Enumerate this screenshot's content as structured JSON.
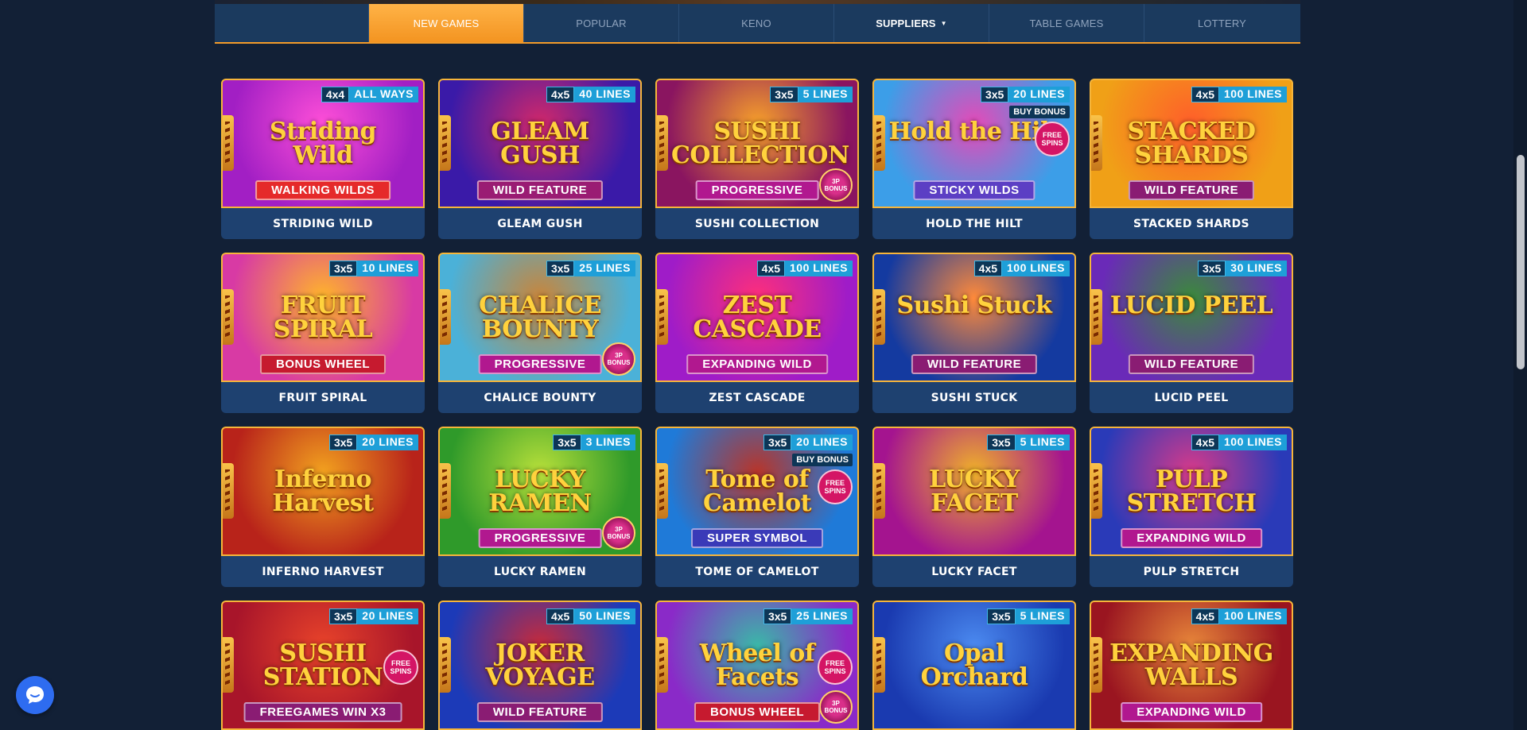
{
  "nav": {
    "tabs": [
      {
        "label": "NEW GAMES",
        "active": true
      },
      {
        "label": "POPULAR",
        "active": false
      },
      {
        "label": "KENO",
        "active": false
      },
      {
        "label": "SUPPLIERS",
        "active": false,
        "dropdown": true
      },
      {
        "label": "TABLE GAMES",
        "active": false
      },
      {
        "label": "LOTTERY",
        "active": false
      }
    ]
  },
  "games": [
    {
      "name": "STRIDING WILD",
      "art_title": "Striding Wild",
      "grid": "4x4",
      "lines": "ALL WAYS",
      "feature": "WALKING WILDS",
      "feature_color": "#e52a2a",
      "bg": "#a21fc4",
      "bg2": "#ff4fd8"
    },
    {
      "name": "GLEAM GUSH",
      "art_title": "GLEAM GUSH",
      "grid": "4x5",
      "lines": "40 LINES",
      "feature": "WILD FEATURE",
      "feature_color": "#9a1c73",
      "bg": "#3a1aa8",
      "bg2": "#d2286a"
    },
    {
      "name": "SUSHI COLLECTION",
      "art_title": "SUSHI COLLECTION",
      "grid": "3x5",
      "lines": "5 LINES",
      "feature": "PROGRESSIVE",
      "feature_color": "#b1188f",
      "bg": "#8a1560",
      "bg2": "#f7a02a",
      "bonus_coin": "3P BONUS"
    },
    {
      "name": "HOLD THE HILT",
      "art_title": "Hold the Hilt",
      "grid": "3x5",
      "lines": "20 LINES",
      "feature": "STICKY WILDS",
      "feature_color": "#5c3fc4",
      "bg": "#3c9ee8",
      "bg2": "#e54ab8",
      "extra": "BUY BONUS",
      "free_spins": "FREE SPINS"
    },
    {
      "name": "STACKED SHARDS",
      "art_title": "STACKED SHARDS",
      "grid": "4x5",
      "lines": "100 LINES",
      "feature": "WILD FEATURE",
      "feature_color": "#8a1c73",
      "bg": "#f0a017",
      "bg2": "#ff5e2a"
    },
    {
      "name": "FRUIT SPIRAL",
      "art_title": "FRUIT SPIRAL",
      "grid": "3x5",
      "lines": "10 LINES",
      "feature": "BONUS WHEEL",
      "feature_color": "#c61a2f",
      "bg": "#d83aa4",
      "bg2": "#ffb52a"
    },
    {
      "name": "CHALICE BOUNTY",
      "art_title": "CHALICE BOUNTY",
      "grid": "3x5",
      "lines": "25 LINES",
      "feature": "PROGRESSIVE",
      "feature_color": "#b1188f",
      "bg": "#4bb1d8",
      "bg2": "#c9853a",
      "bonus_coin": "3P BONUS"
    },
    {
      "name": "ZEST CASCADE",
      "art_title": "ZEST CASCADE",
      "grid": "4x5",
      "lines": "100 LINES",
      "feature": "EXPANDING WILD",
      "feature_color": "#b1188f",
      "bg": "#9f1cc8",
      "bg2": "#ff2f7a"
    },
    {
      "name": "SUSHI STUCK",
      "art_title": "Sushi Stuck",
      "grid": "4x5",
      "lines": "100 LINES",
      "feature": "WILD FEATURE",
      "feature_color": "#8a1c73",
      "bg": "#143aa0",
      "bg2": "#ff8a3a"
    },
    {
      "name": "LUCID PEEL",
      "art_title": "LUCID PEEL",
      "grid": "3x5",
      "lines": "30 LINES",
      "feature": "WILD FEATURE",
      "feature_color": "#8a1c73",
      "bg": "#6a2ab8",
      "bg2": "#3b8a3b"
    },
    {
      "name": "INFERNO HARVEST",
      "art_title": "Inferno Harvest",
      "grid": "3x5",
      "lines": "20 LINES",
      "feature": "",
      "feature_color": "",
      "bg": "#b8231a",
      "bg2": "#f2a11f"
    },
    {
      "name": "LUCKY RAMEN",
      "art_title": "LUCKY RAMEN",
      "grid": "3x5",
      "lines": "3 LINES",
      "feature": "PROGRESSIVE",
      "feature_color": "#b1188f",
      "bg": "#2f9a2a",
      "bg2": "#b8e03a",
      "bonus_coin": "3P BONUS"
    },
    {
      "name": "TOME OF CAMELOT",
      "art_title": "Tome of Camelot",
      "grid": "3x5",
      "lines": "20 LINES",
      "feature": "SUPER SYMBOL",
      "feature_color": "#3a3ab8",
      "bg": "#1f7ad8",
      "bg2": "#b8352a",
      "extra": "BUY BONUS",
      "free_spins": "FREE SPINS"
    },
    {
      "name": "LUCKY FACET",
      "art_title": "LUCKY FACET",
      "grid": "3x5",
      "lines": "5 LINES",
      "feature": "",
      "feature_color": "",
      "bg": "#a4148f",
      "bg2": "#f0b12a"
    },
    {
      "name": "PULP STRETCH",
      "art_title": "PULP STRETCH",
      "grid": "4x5",
      "lines": "100 LINES",
      "feature": "EXPANDING WILD",
      "feature_color": "#b1188f",
      "bg": "#2a3ab8",
      "bg2": "#d83a8a"
    },
    {
      "name": "SUSHI STATION",
      "art_title": "SUSHI STATION",
      "grid": "3x5",
      "lines": "20 LINES",
      "feature": "FREEGAMES WIN X3",
      "feature_color": "#8a1c73",
      "bg": "#a8152a",
      "bg2": "#e8432a",
      "free_spins": "FREE SPINS"
    },
    {
      "name": "JOKER VOYAGE",
      "art_title": "JOKER VOYAGE",
      "grid": "4x5",
      "lines": "50 LINES",
      "feature": "WILD FEATURE",
      "feature_color": "#8a1c73",
      "bg": "#1c3ab8",
      "bg2": "#c82a3a"
    },
    {
      "name": "WHEEL OF FACETS",
      "art_title": "Wheel of Facets",
      "grid": "3x5",
      "lines": "25 LINES",
      "feature": "BONUS WHEEL",
      "feature_color": "#c61a2f",
      "bg": "#8a2ac8",
      "bg2": "#3ab8a8",
      "free_spins": "FREE SPINS",
      "bonus_coin": "3P BONUS"
    },
    {
      "name": "OPAL ORCHARD",
      "art_title": "Opal Orchard",
      "grid": "3x5",
      "lines": "5 LINES",
      "feature": "",
      "feature_color": "",
      "bg": "#1a3ab0",
      "bg2": "#4b8af0"
    },
    {
      "name": "EXPANDING WALLS",
      "art_title": "EXPANDING WALLS",
      "grid": "4x5",
      "lines": "100 LINES",
      "feature": "EXPANDING WILD",
      "feature_color": "#b1188f",
      "bg": "#9a1520",
      "bg2": "#e8873a"
    }
  ],
  "colors": {
    "background": "#122036",
    "nav_bg": "#1b3a5e",
    "accent": "#f39421",
    "caption_bg": "#1e4170",
    "card_border": "#f6b53a",
    "chat_button": "#2e6cf0"
  },
  "icons": {
    "chat": "chat-bubble-smile-icon",
    "dropdown": "caret-down-icon"
  }
}
